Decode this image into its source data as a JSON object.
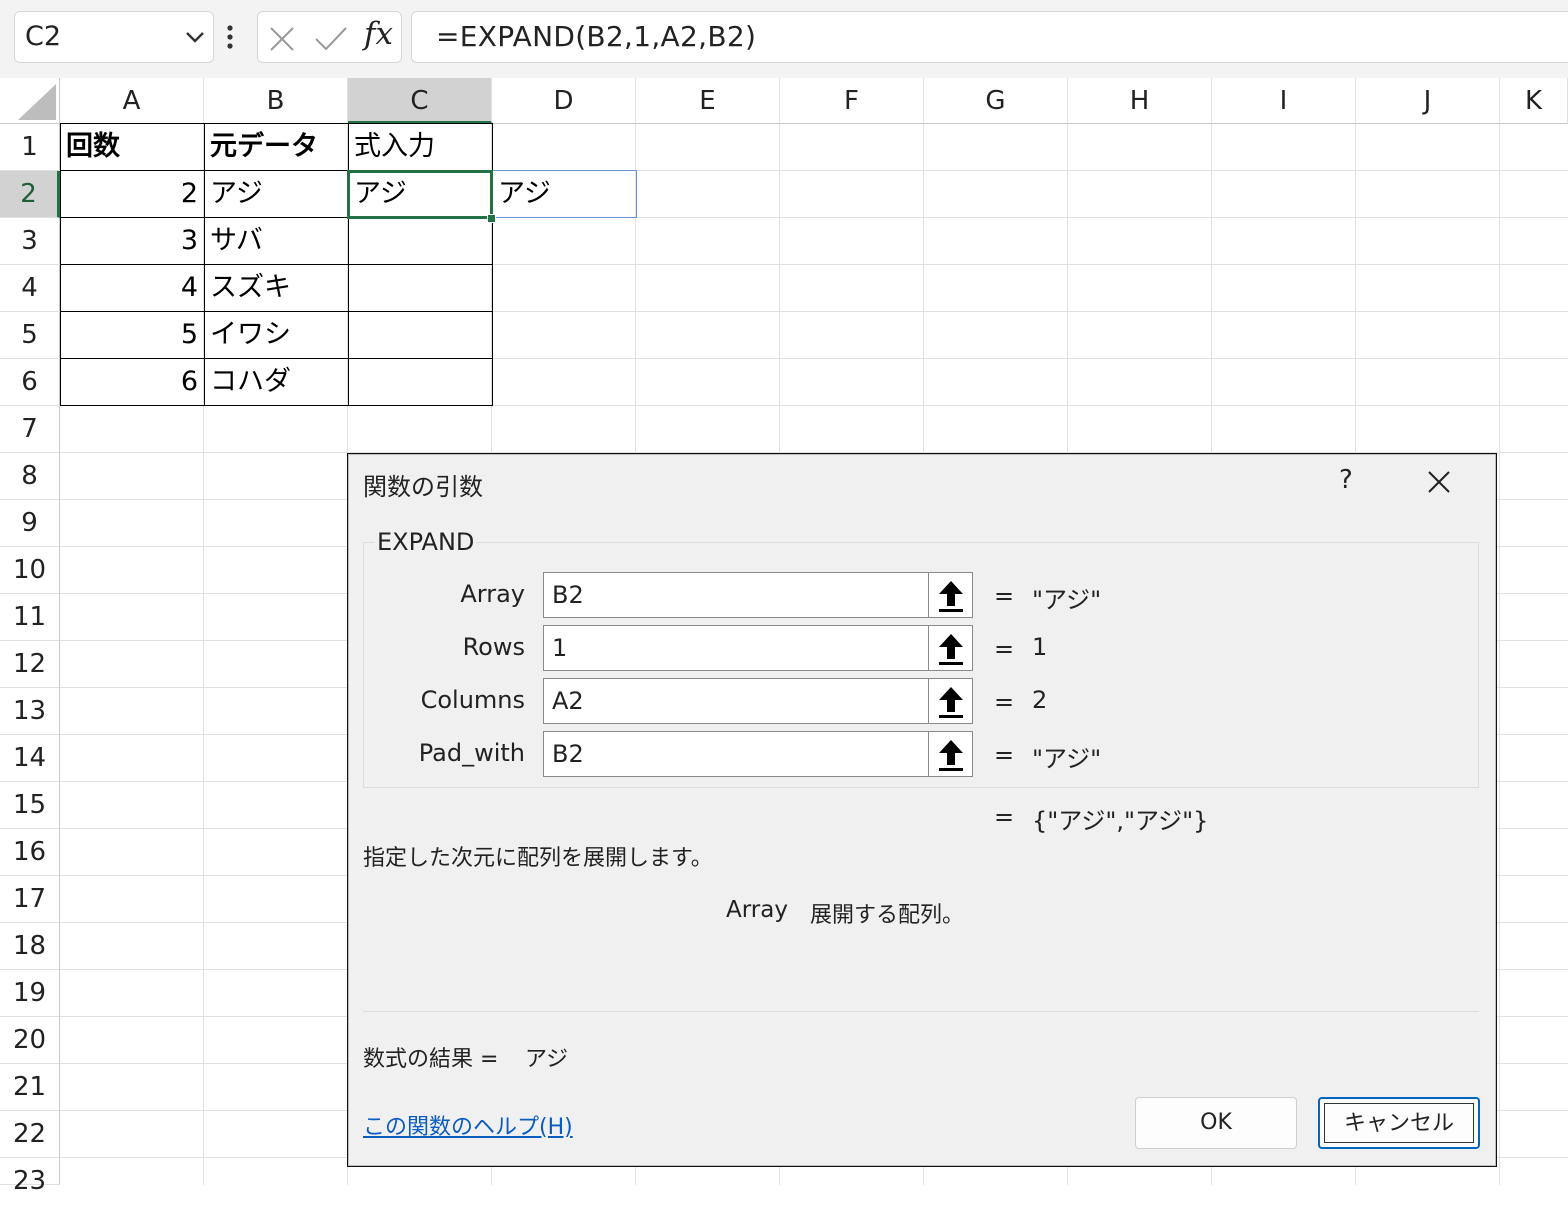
{
  "formula_bar": {
    "name_box": "C2",
    "fx_label": "fx",
    "formula": "=EXPAND(B2,1,A2,B2)"
  },
  "grid": {
    "columns": [
      "A",
      "B",
      "C",
      "D",
      "E",
      "F",
      "G",
      "H",
      "I",
      "J",
      "K"
    ],
    "rows": [
      "1",
      "2",
      "3",
      "4",
      "5",
      "6",
      "7",
      "8",
      "9",
      "10",
      "11",
      "12",
      "13",
      "14",
      "15",
      "16",
      "17",
      "18",
      "19",
      "20",
      "21",
      "22",
      "23"
    ],
    "selected_column": "C",
    "selected_row": "2",
    "cells": {
      "A1": "回数",
      "B1": "元データ",
      "C1": "式入力",
      "A2": "2",
      "B2": "アジ",
      "C2": "アジ",
      "D2": "アジ",
      "A3": "3",
      "B3": "サバ",
      "A4": "4",
      "B4": "スズキ",
      "A5": "5",
      "B5": "イワシ",
      "A6": "6",
      "B6": "コハダ"
    }
  },
  "dialog": {
    "title": "関数の引数",
    "help_symbol": "?",
    "function_name": "EXPAND",
    "args": [
      {
        "label": "Array",
        "value": "B2",
        "eq": "=",
        "result": "\"アジ\""
      },
      {
        "label": "Rows",
        "value": "1",
        "eq": "=",
        "result": "1"
      },
      {
        "label": "Columns",
        "value": "A2",
        "eq": "=",
        "result": "2"
      },
      {
        "label": "Pad_with",
        "value": "B2",
        "eq": "=",
        "result": "\"アジ\""
      }
    ],
    "result_eq": "=",
    "result_value": "{\"アジ\",\"アジ\"}",
    "description": "指定した次元に配列を展開します。",
    "arg_help_name": "Array",
    "arg_help_text": "展開する配列。",
    "formula_result_label": "数式の結果 =",
    "formula_result_value": "アジ",
    "help_link": "この関数のヘルプ(H)",
    "ok_label": "OK",
    "cancel_label": "キャンセル"
  },
  "colors": {
    "accent_green": "#217346",
    "link_blue": "#0a5cc0",
    "spill_blue": "#6b93d6"
  }
}
